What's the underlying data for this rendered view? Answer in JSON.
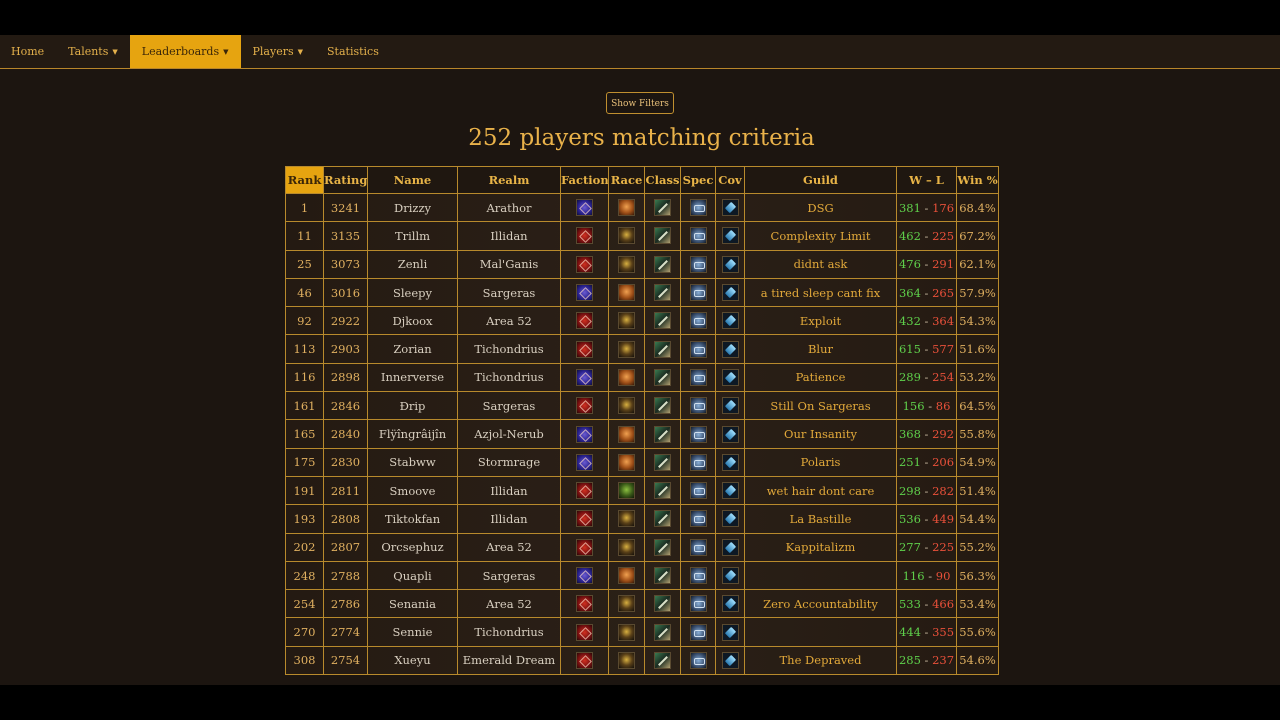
{
  "nav": {
    "items": [
      {
        "label": "Home",
        "active": false,
        "dropdown": false
      },
      {
        "label": "Talents",
        "active": false,
        "dropdown": true
      },
      {
        "label": "Leaderboards",
        "active": true,
        "dropdown": true
      },
      {
        "label": "Players",
        "active": false,
        "dropdown": true
      },
      {
        "label": "Statistics",
        "active": false,
        "dropdown": false
      }
    ]
  },
  "filters_button": "Show Filters",
  "heading": "252 players matching criteria",
  "colors": {
    "accent": "#e6a410",
    "wins": "#5fd04b",
    "losses": "#e8503a",
    "guild": "#e2a93a"
  },
  "table": {
    "headers": [
      "Rank",
      "Rating",
      "Name",
      "Realm",
      "Faction",
      "Race",
      "Class",
      "Spec",
      "Cov",
      "Guild",
      "W – L",
      "Win %"
    ],
    "rows": [
      {
        "rank": "1",
        "rating": "3241",
        "name": "Drizzy",
        "realm": "Arathor",
        "faction": "alliance",
        "race": "race-a",
        "guild": "DSG",
        "wins": "381",
        "losses": "176",
        "winpct": "68.4%"
      },
      {
        "rank": "11",
        "rating": "3135",
        "name": "Trillm",
        "realm": "Illidan",
        "faction": "horde",
        "race": "race-b",
        "guild": "Complexity Limit",
        "wins": "462",
        "losses": "225",
        "winpct": "67.2%"
      },
      {
        "rank": "25",
        "rating": "3073",
        "name": "Zenli",
        "realm": "Mal'Ganis",
        "faction": "horde",
        "race": "race-b",
        "guild": "didnt ask",
        "wins": "476",
        "losses": "291",
        "winpct": "62.1%"
      },
      {
        "rank": "46",
        "rating": "3016",
        "name": "Sleepy",
        "realm": "Sargeras",
        "faction": "alliance",
        "race": "race-a",
        "guild": "a tired sleep cant fix",
        "wins": "364",
        "losses": "265",
        "winpct": "57.9%"
      },
      {
        "rank": "92",
        "rating": "2922",
        "name": "Djkoox",
        "realm": "Area 52",
        "faction": "horde",
        "race": "race-b",
        "guild": "Exploit",
        "wins": "432",
        "losses": "364",
        "winpct": "54.3%"
      },
      {
        "rank": "113",
        "rating": "2903",
        "name": "Zorian",
        "realm": "Tichondrius",
        "faction": "horde",
        "race": "race-b",
        "guild": "Blur",
        "wins": "615",
        "losses": "577",
        "winpct": "51.6%"
      },
      {
        "rank": "116",
        "rating": "2898",
        "name": "Innerverse",
        "realm": "Tichondrius",
        "faction": "alliance",
        "race": "race-a",
        "guild": "Patience",
        "wins": "289",
        "losses": "254",
        "winpct": "53.2%"
      },
      {
        "rank": "161",
        "rating": "2846",
        "name": "Đrip",
        "realm": "Sargeras",
        "faction": "horde",
        "race": "race-b",
        "guild": "Still On Sargeras",
        "wins": "156",
        "losses": "86",
        "winpct": "64.5%"
      },
      {
        "rank": "165",
        "rating": "2840",
        "name": "Flÿîngrâijîn",
        "realm": "Azjol-Nerub",
        "faction": "alliance",
        "race": "race-a",
        "guild": "Our Insanity",
        "wins": "368",
        "losses": "292",
        "winpct": "55.8%"
      },
      {
        "rank": "175",
        "rating": "2830",
        "name": "Stabww",
        "realm": "Stormrage",
        "faction": "alliance",
        "race": "race-a",
        "guild": "Polaris",
        "wins": "251",
        "losses": "206",
        "winpct": "54.9%"
      },
      {
        "rank": "191",
        "rating": "2811",
        "name": "Smoove",
        "realm": "Illidan",
        "faction": "horde",
        "race": "race-c",
        "guild": "wet hair dont care",
        "wins": "298",
        "losses": "282",
        "winpct": "51.4%"
      },
      {
        "rank": "193",
        "rating": "2808",
        "name": "Tiktokfan",
        "realm": "Illidan",
        "faction": "horde",
        "race": "race-b",
        "guild": "La Bastille",
        "wins": "536",
        "losses": "449",
        "winpct": "54.4%"
      },
      {
        "rank": "202",
        "rating": "2807",
        "name": "Orcsephuz",
        "realm": "Area 52",
        "faction": "horde",
        "race": "race-b",
        "guild": "Kappitalizm",
        "wins": "277",
        "losses": "225",
        "winpct": "55.2%"
      },
      {
        "rank": "248",
        "rating": "2788",
        "name": "Quapli",
        "realm": "Sargeras",
        "faction": "alliance",
        "race": "race-a",
        "guild": "",
        "wins": "116",
        "losses": "90",
        "winpct": "56.3%"
      },
      {
        "rank": "254",
        "rating": "2786",
        "name": "Senania",
        "realm": "Area 52",
        "faction": "horde",
        "race": "race-b",
        "guild": "Zero Accountability",
        "wins": "533",
        "losses": "466",
        "winpct": "53.4%"
      },
      {
        "rank": "270",
        "rating": "2774",
        "name": "Sennie",
        "realm": "Tichondrius",
        "faction": "horde",
        "race": "race-b",
        "guild": "",
        "wins": "444",
        "losses": "355",
        "winpct": "55.6%"
      },
      {
        "rank": "308",
        "rating": "2754",
        "name": "Xueyu",
        "realm": "Emerald Dream",
        "faction": "horde",
        "race": "race-b",
        "guild": "The Depraved",
        "wins": "285",
        "losses": "237",
        "winpct": "54.6%"
      }
    ]
  }
}
